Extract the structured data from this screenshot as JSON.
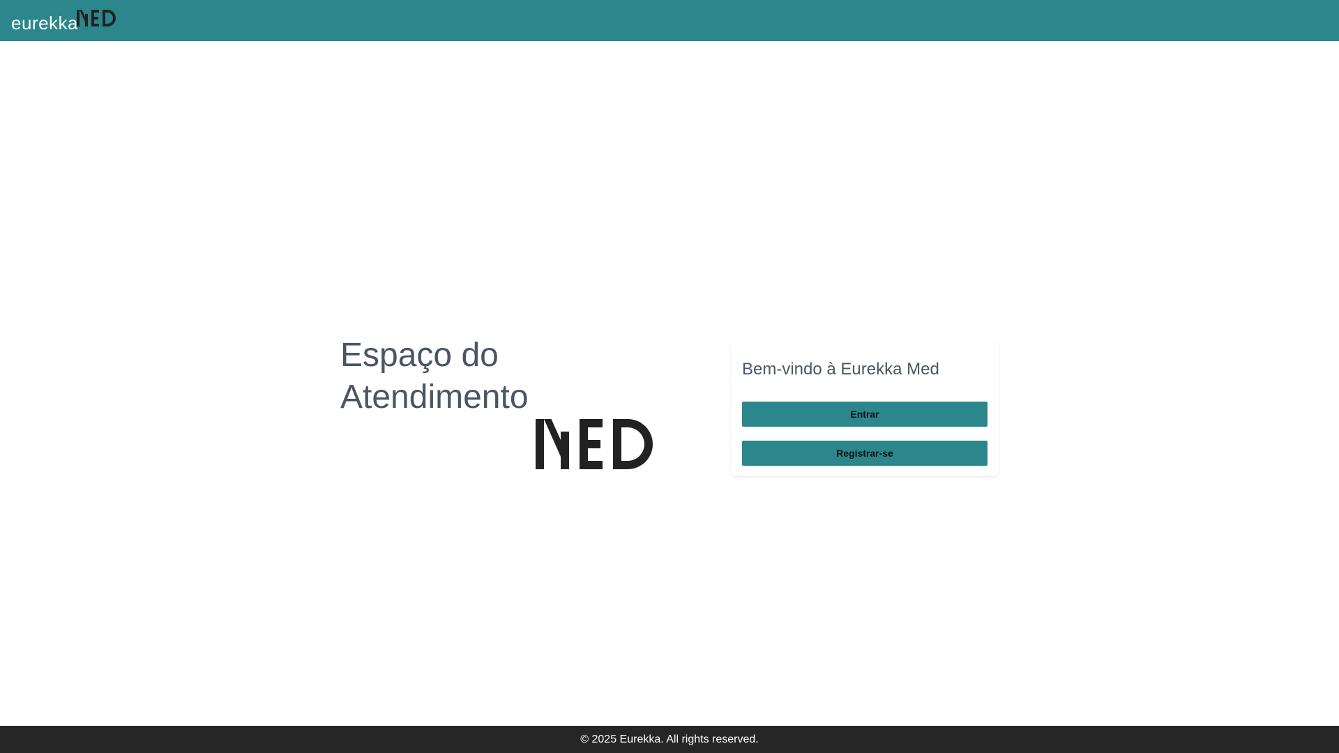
{
  "header": {
    "logo_word": "eurekka",
    "logo_mark": "MED",
    "logo_mark_color": "#222222"
  },
  "hero": {
    "title": "Espaço do Atendimento",
    "logo_mark": "MED"
  },
  "card": {
    "title": "Bem-vindo à Eurekka Med",
    "login_label": "Entrar",
    "register_label": "Registrar-se"
  },
  "footer": {
    "copyright": "© 2025 Eurekka. All rights reserved."
  },
  "colors": {
    "brand": "#2b878b",
    "footer_bg": "#262626",
    "heading_text": "#4a5565"
  }
}
